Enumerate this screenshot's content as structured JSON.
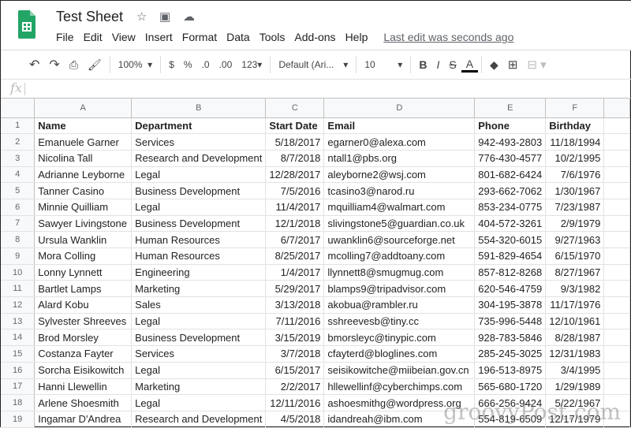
{
  "app": {
    "title": "Test Sheet",
    "last_edit": "Last edit was seconds ago",
    "brand_color": "#23a566"
  },
  "menu": [
    "File",
    "Edit",
    "View",
    "Insert",
    "Format",
    "Data",
    "Tools",
    "Add-ons",
    "Help"
  ],
  "toolbar": {
    "zoom": "100%",
    "currency": "$",
    "percent": "%",
    "dec_less": ".0",
    "dec_more": ".00",
    "format": "123",
    "font": "Default (Ari...",
    "size": "10",
    "bold": "B",
    "italic": "I",
    "strike": "S",
    "text_color": "A"
  },
  "formula_bar": {
    "label": "fx",
    "value": ""
  },
  "columns": [
    "A",
    "B",
    "C",
    "D",
    "E",
    "F",
    ""
  ],
  "rows": [
    [
      "Name",
      "Department",
      "Start Date",
      "Email",
      "Phone",
      "Birthday"
    ],
    [
      "Emanuele Garner",
      "Services",
      "5/18/2017",
      "egarner0@alexa.com",
      "942-493-2803",
      "11/18/1994"
    ],
    [
      "Nicolina Tall",
      "Research and Development",
      "8/7/2018",
      "ntall1@pbs.org",
      "776-430-4577",
      "10/2/1995"
    ],
    [
      "Adrianne Leyborne",
      "Legal",
      "12/28/2017",
      "aleyborne2@wsj.com",
      "801-682-6424",
      "7/6/1976"
    ],
    [
      "Tanner Casino",
      "Business Development",
      "7/5/2016",
      "tcasino3@narod.ru",
      "293-662-7062",
      "1/30/1967"
    ],
    [
      "Minnie Quilliam",
      "Legal",
      "11/4/2017",
      "mquilliam4@walmart.com",
      "853-234-0775",
      "7/23/1987"
    ],
    [
      "Sawyer Livingstone",
      "Business Development",
      "12/1/2018",
      "slivingstone5@guardian.co.uk",
      "404-572-3261",
      "2/9/1979"
    ],
    [
      "Ursula Wanklin",
      "Human Resources",
      "6/7/2017",
      "uwanklin6@sourceforge.net",
      "554-320-6015",
      "9/27/1963"
    ],
    [
      "Mora Colling",
      "Human Resources",
      "8/25/2017",
      "mcolling7@addtoany.com",
      "591-829-4654",
      "6/15/1970"
    ],
    [
      "Lonny Lynnett",
      "Engineering",
      "1/4/2017",
      "llynnett8@smugmug.com",
      "857-812-8268",
      "8/27/1967"
    ],
    [
      "Bartlet Lamps",
      "Marketing",
      "5/29/2017",
      "blamps9@tripadvisor.com",
      "620-546-4759",
      "9/3/1982"
    ],
    [
      "Alard Kobu",
      "Sales",
      "3/13/2018",
      "akobua@rambler.ru",
      "304-195-3878",
      "11/17/1976"
    ],
    [
      "Sylvester Shreeves",
      "Legal",
      "7/11/2016",
      "sshreevesb@tiny.cc",
      "735-996-5448",
      "12/10/1961"
    ],
    [
      "Brod Morsley",
      "Business Development",
      "3/15/2019",
      "bmorsleyc@tinypic.com",
      "928-783-5846",
      "8/28/1987"
    ],
    [
      "Costanza Fayter",
      "Services",
      "3/7/2018",
      "cfayterd@bloglines.com",
      "285-245-3025",
      "12/31/1983"
    ],
    [
      "Sorcha Eisikowitch",
      "Legal",
      "6/15/2017",
      "seisikowitche@miibeian.gov.cn",
      "196-513-8975",
      "3/4/1995"
    ],
    [
      "Hanni Llewellin",
      "Marketing",
      "2/2/2017",
      "hllewellinf@cyberchimps.com",
      "565-680-1720",
      "1/29/1989"
    ],
    [
      "Arlene Shoesmith",
      "Legal",
      "12/11/2016",
      "ashoesmithg@wordpress.org",
      "666-256-9424",
      "5/22/1967"
    ],
    [
      "Ingamar D'Andrea",
      "Research and Development",
      "4/5/2018",
      "idandreah@ibm.com",
      "554-819-6509",
      "12/17/1979"
    ]
  ],
  "watermark": "groovyPost.com"
}
